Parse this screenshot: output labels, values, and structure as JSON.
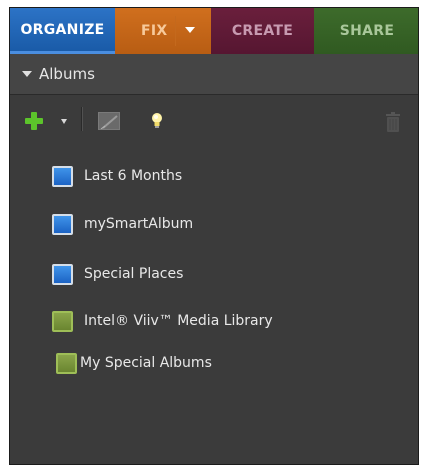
{
  "tabs": [
    {
      "label": "ORGANIZE",
      "active": true
    },
    {
      "label": "FIX",
      "has_dropdown": true
    },
    {
      "label": "CREATE"
    },
    {
      "label": "SHARE"
    }
  ],
  "panel": {
    "header": "Albums"
  },
  "toolbar": {
    "icons": [
      "add-icon",
      "dropdown-caret-icon",
      "edit-icon",
      "lightbulb-icon",
      "trash-icon"
    ]
  },
  "albums": [
    {
      "label": "Last 6 Months",
      "color": "blue"
    },
    {
      "label": "mySmartAlbum",
      "color": "blue"
    },
    {
      "label": "Special Places",
      "color": "blue"
    },
    {
      "label": "Intel® Viiv™ Media Library",
      "color": "green"
    },
    {
      "label": "My Special Albums",
      "color": "green"
    }
  ],
  "colors": {
    "organize": "#1f62b4",
    "fix": "#c0641a",
    "create": "#5c1a34",
    "share": "#345e25",
    "panel_bg": "#3b3b3b"
  }
}
